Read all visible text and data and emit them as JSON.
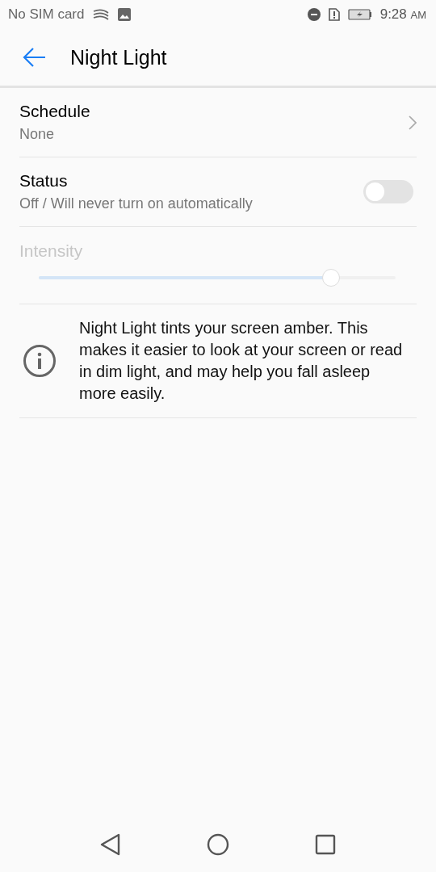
{
  "status_bar": {
    "carrier": "No SIM card",
    "time": "9:28",
    "ampm": "AM"
  },
  "header": {
    "title": "Night Light"
  },
  "schedule": {
    "label": "Schedule",
    "value": "None"
  },
  "status": {
    "label": "Status",
    "summary": "Off / Will never turn on automatically",
    "on": false
  },
  "intensity": {
    "label": "Intensity",
    "disabled": true,
    "level": 0.82
  },
  "info": {
    "text": "Night Light tints your screen amber. This makes it easier to look at your screen or read in dim light, and may help you fall asleep more easily."
  }
}
